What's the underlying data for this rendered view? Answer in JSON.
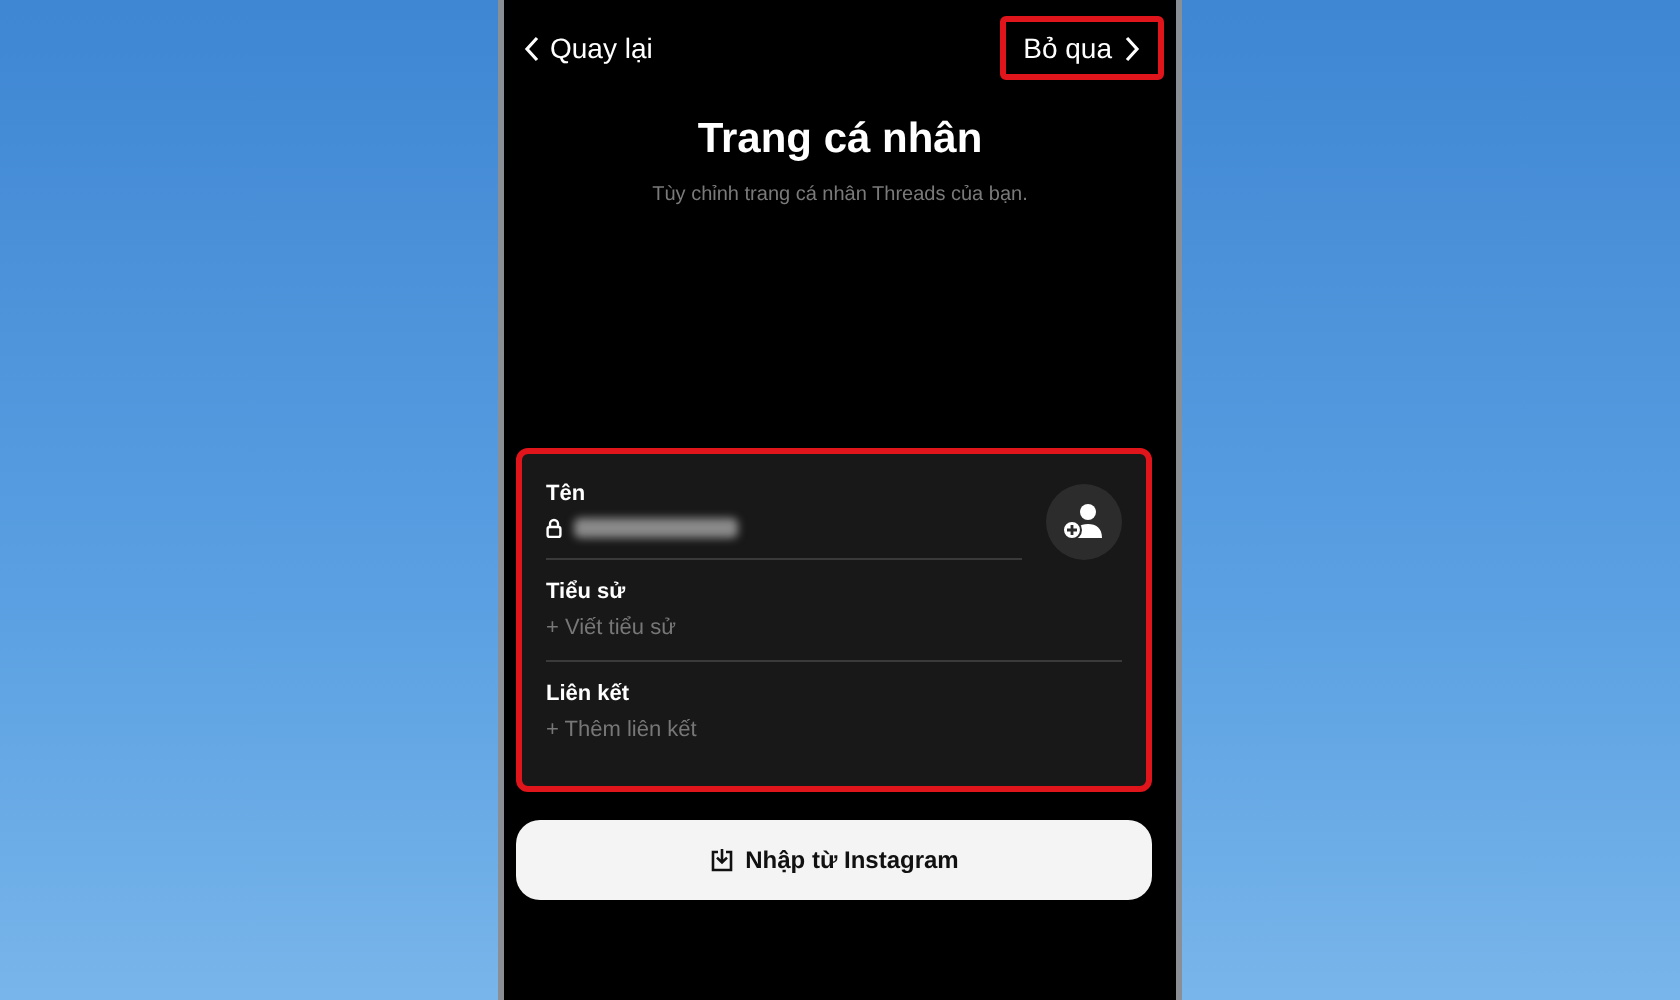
{
  "header": {
    "back": {
      "label": "Quay lại"
    },
    "skip": {
      "label": "Bỏ qua",
      "highlighted": true
    }
  },
  "title": "Trang cá nhân",
  "subtitle": "Tùy chỉnh trang cá nhân Threads của bạn.",
  "card": {
    "highlighted": true,
    "fields": [
      {
        "kind": "locked",
        "label": "Tên",
        "redacted": true
      },
      {
        "kind": "add",
        "label": "Tiểu sử",
        "placeholder": "+ Viết tiểu sử"
      },
      {
        "kind": "add",
        "label": "Liên kết",
        "placeholder": "+ Thêm liên kết"
      }
    ]
  },
  "import_button": {
    "label": "Nhập từ Instagram"
  }
}
